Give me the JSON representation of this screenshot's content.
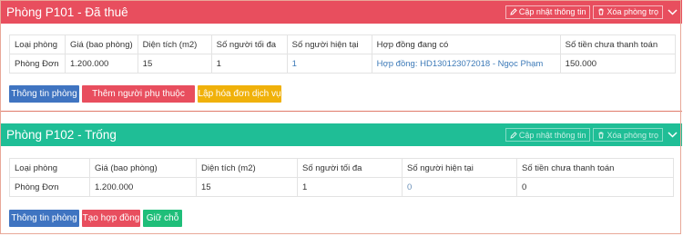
{
  "header_actions": {
    "update": "Cập nhật thông tin",
    "delete": "Xóa phòng trọ"
  },
  "columns": [
    "Loại phòng",
    "Giá (bao phòng)",
    "Diện tích (m2)",
    "Số người tối đa",
    "Số người hiện tại",
    "Hợp đồng đang có",
    "Số tiền chưa thanh toán"
  ],
  "room1": {
    "title": "Phòng P101 - Đã thuê",
    "row": {
      "type": "Phòng Đơn",
      "price": "1.200.000",
      "area": "15",
      "max": "1",
      "current": "1",
      "contract": "Hợp đồng: HD130123072018 - Ngọc Phạm",
      "unpaid": "150.000"
    },
    "buttons": {
      "info": "Thông tin phòng",
      "add_dependent": "Thêm người phụ thuộc",
      "invoice": "Lập hóa đơn dịch vụ"
    }
  },
  "room2": {
    "title": "Phòng P102 - Trống",
    "row": {
      "type": "Phòng Đơn",
      "price": "1.200.000",
      "area": "15",
      "max": "1",
      "current": "0",
      "unpaid": "0"
    },
    "buttons": {
      "info": "Thông tin phòng",
      "create_contract": "Tạo hợp đồng",
      "hold": "Giữ chỗ"
    }
  },
  "colors": {
    "rented": "#e84e5e",
    "vacant": "#1fbe96",
    "blue": "#3f74c1",
    "yellow": "#f0b10a",
    "green": "#1fbe79"
  },
  "icons": [
    "pencil-icon",
    "trash-icon",
    "chevron-down-icon"
  ]
}
